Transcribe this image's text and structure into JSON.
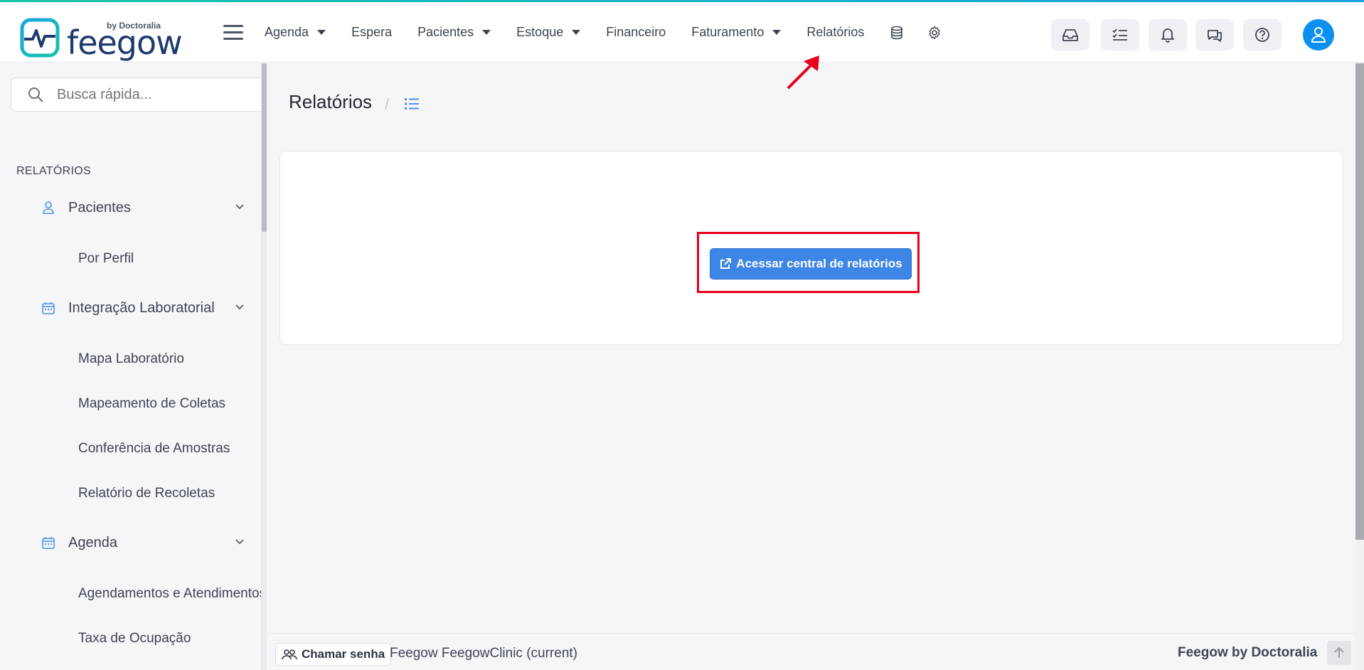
{
  "app": {
    "logo_by": "by Doctoralia",
    "logo_text": "feegow"
  },
  "nav": {
    "items": [
      {
        "label": "Agenda",
        "dropdown": true
      },
      {
        "label": "Espera",
        "dropdown": false
      },
      {
        "label": "Pacientes",
        "dropdown": true
      },
      {
        "label": "Estoque",
        "dropdown": true
      },
      {
        "label": "Financeiro",
        "dropdown": false
      },
      {
        "label": "Faturamento",
        "dropdown": true
      },
      {
        "label": "Relatórios",
        "dropdown": false
      }
    ],
    "icons": [
      "database-icon",
      "gear-icon"
    ],
    "right_icons": [
      "inbox-icon",
      "checklist-icon",
      "bell-icon",
      "chat-icon",
      "help-icon",
      "user-avatar-icon"
    ]
  },
  "sidebar": {
    "search_placeholder": "Busca rápida...",
    "section_title": "RELATÓRIOS",
    "groups": [
      {
        "label": "Pacientes",
        "icon": "user-icon",
        "items": [
          "Por Perfil"
        ]
      },
      {
        "label": "Integração Laboratorial",
        "icon": "calendar-icon",
        "items": [
          "Mapa Laboratório",
          "Mapeamento de Coletas",
          "Conferência de Amostras",
          "Relatório de Recoletas"
        ]
      },
      {
        "label": "Agenda",
        "icon": "calendar-icon",
        "items": [
          "Agendamentos e Atendimentos",
          "Taxa de Ocupação"
        ]
      }
    ]
  },
  "main": {
    "title": "Relatórios",
    "breadcrumb_sep": "/",
    "action_button": "Acessar central de relatórios"
  },
  "footer": {
    "chamar_label": "Chamar senha",
    "clinic_text": "Feegow FeegowClinic (current)",
    "brand": "Feegow by Doctoralia"
  },
  "colors": {
    "primary": "#3e86e6",
    "avatar": "#0d8ff0",
    "highlight": "#e8001c",
    "accent_teal": "#18c4a8"
  }
}
